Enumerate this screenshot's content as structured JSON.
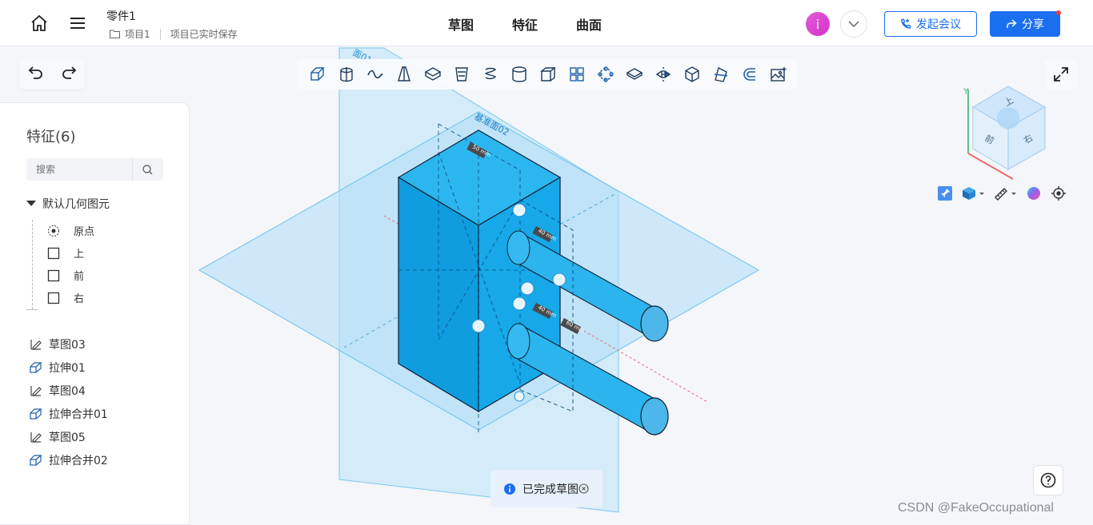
{
  "header": {
    "doc_title": "零件1",
    "project": "项目1",
    "save_status": "项目已实时保存",
    "tabs": [
      "草图",
      "特征",
      "曲面"
    ],
    "avatar_letter": "i",
    "meeting_label": "发起会议",
    "share_label": "分享"
  },
  "panel": {
    "title": "特征(6)",
    "search_placeholder": "搜索",
    "group_label": "默认几何图元",
    "geometry": [
      "原点",
      "上",
      "前",
      "右"
    ],
    "features": [
      {
        "label": "草图03",
        "icon": "sketch-icon"
      },
      {
        "label": "拉伸01",
        "icon": "extrude-icon"
      },
      {
        "label": "草图04",
        "icon": "sketch-icon"
      },
      {
        "label": "拉伸合并01",
        "icon": "extrude-icon"
      },
      {
        "label": "草图05",
        "icon": "sketch-icon"
      },
      {
        "label": "拉伸合并02",
        "icon": "extrude-icon"
      }
    ]
  },
  "viewport": {
    "plane_label": "基准面02",
    "plane_label_top": "面01",
    "dims": [
      "50 mm",
      "40 mm",
      "40 mm",
      "60 mm"
    ],
    "viewcube": {
      "top": "上",
      "front": "前",
      "right": "右",
      "y_axis": "Y"
    }
  },
  "toast": "已完成草图",
  "watermark": "CSDN @FakeOccupational",
  "colors": {
    "accent": "#1a6ff0",
    "solid": "#18a6e6",
    "plane": "#9dd6f5"
  }
}
